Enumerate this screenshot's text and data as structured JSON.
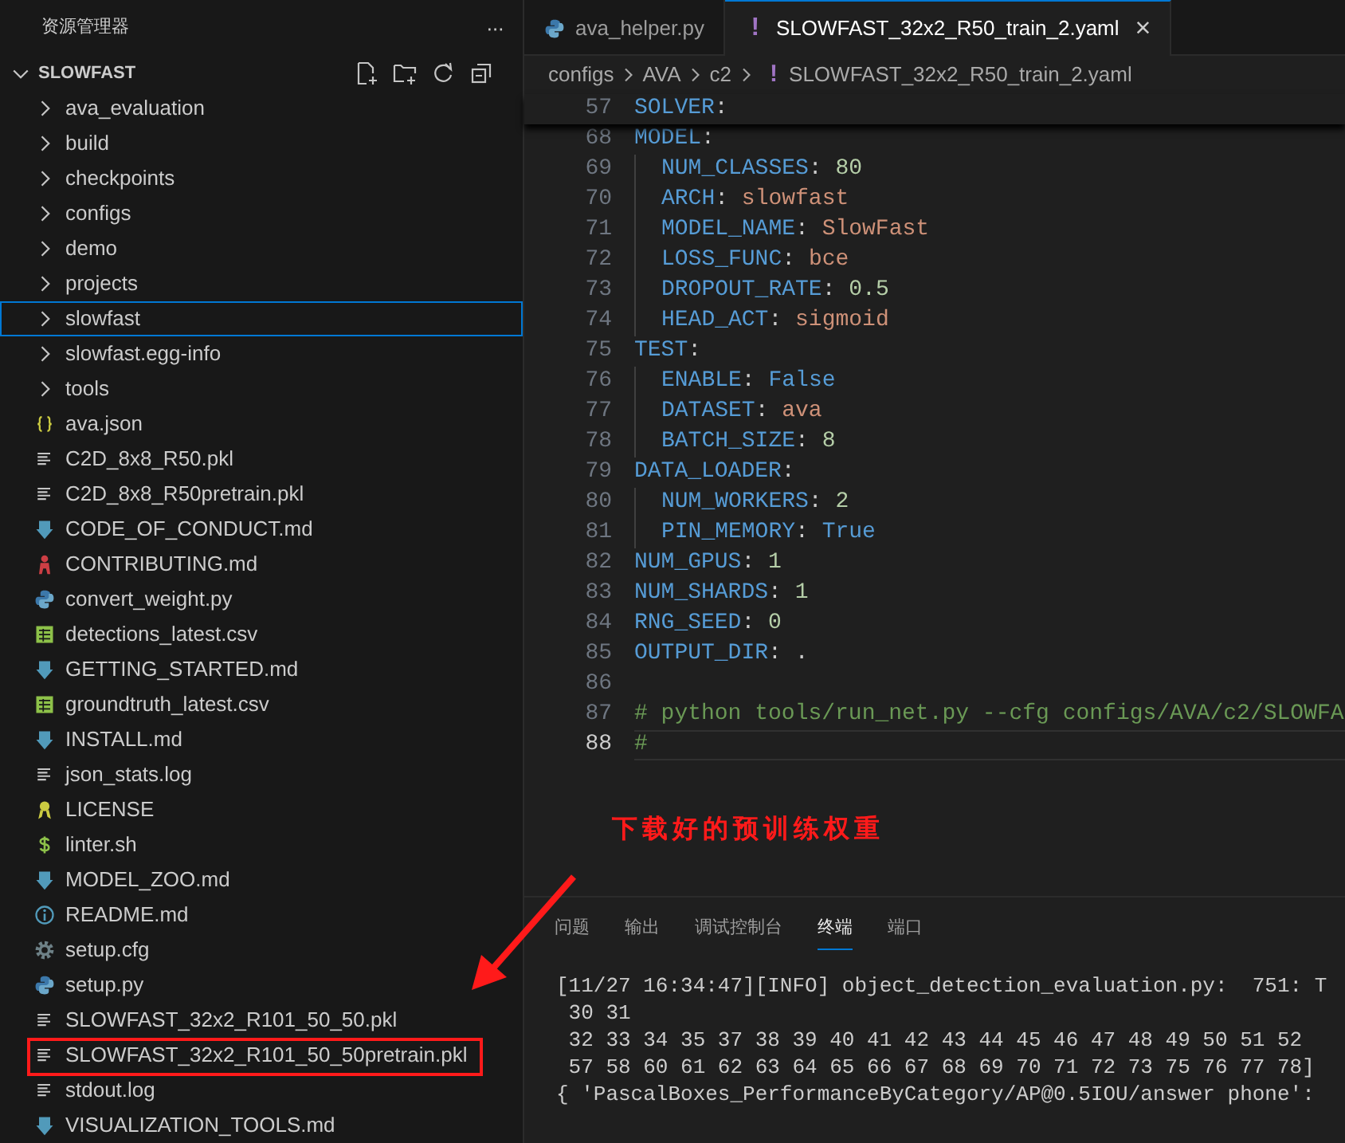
{
  "explorer": {
    "title": "资源管理器",
    "more": "···",
    "root": {
      "label": "SLOWFAST",
      "expanded": true
    },
    "items": [
      {
        "label": "ava_evaluation",
        "kind": "folder",
        "focused": false,
        "annotated": false
      },
      {
        "label": "build",
        "kind": "folder",
        "focused": false,
        "annotated": false
      },
      {
        "label": "checkpoints",
        "kind": "folder",
        "focused": false,
        "annotated": false
      },
      {
        "label": "configs",
        "kind": "folder",
        "focused": false,
        "annotated": false
      },
      {
        "label": "demo",
        "kind": "folder",
        "focused": false,
        "annotated": false
      },
      {
        "label": "projects",
        "kind": "folder",
        "focused": false,
        "annotated": false
      },
      {
        "label": "slowfast",
        "kind": "folder",
        "focused": true,
        "annotated": false
      },
      {
        "label": "slowfast.egg-info",
        "kind": "folder",
        "focused": false,
        "annotated": false
      },
      {
        "label": "tools",
        "kind": "folder",
        "focused": false,
        "annotated": false
      },
      {
        "label": "ava.json",
        "kind": "json",
        "focused": false,
        "annotated": false
      },
      {
        "label": "C2D_8x8_R50.pkl",
        "kind": "lines",
        "focused": false,
        "annotated": false
      },
      {
        "label": "C2D_8x8_R50pretrain.pkl",
        "kind": "lines",
        "focused": false,
        "annotated": false
      },
      {
        "label": "CODE_OF_CONDUCT.md",
        "kind": "markdown",
        "focused": false,
        "annotated": false
      },
      {
        "label": "CONTRIBUTING.md",
        "kind": "contributing",
        "focused": false,
        "annotated": false
      },
      {
        "label": "convert_weight.py",
        "kind": "python",
        "focused": false,
        "annotated": false
      },
      {
        "label": "detections_latest.csv",
        "kind": "table",
        "focused": false,
        "annotated": false
      },
      {
        "label": "GETTING_STARTED.md",
        "kind": "markdown",
        "focused": false,
        "annotated": false
      },
      {
        "label": "groundtruth_latest.csv",
        "kind": "table",
        "focused": false,
        "annotated": false
      },
      {
        "label": "INSTALL.md",
        "kind": "markdown",
        "focused": false,
        "annotated": false
      },
      {
        "label": "json_stats.log",
        "kind": "lines",
        "focused": false,
        "annotated": false
      },
      {
        "label": "LICENSE",
        "kind": "license",
        "focused": false,
        "annotated": false
      },
      {
        "label": "linter.sh",
        "kind": "shell",
        "focused": false,
        "annotated": false
      },
      {
        "label": "MODEL_ZOO.md",
        "kind": "markdown",
        "focused": false,
        "annotated": false
      },
      {
        "label": "README.md",
        "kind": "info",
        "focused": false,
        "annotated": false
      },
      {
        "label": "setup.cfg",
        "kind": "gear",
        "focused": false,
        "annotated": false
      },
      {
        "label": "setup.py",
        "kind": "python",
        "focused": false,
        "annotated": false
      },
      {
        "label": "SLOWFAST_32x2_R101_50_50.pkl",
        "kind": "lines",
        "focused": false,
        "annotated": false
      },
      {
        "label": "SLOWFAST_32x2_R101_50_50pretrain.pkl",
        "kind": "lines",
        "focused": false,
        "annotated": true
      },
      {
        "label": "stdout.log",
        "kind": "lines",
        "focused": false,
        "annotated": false
      },
      {
        "label": "VISUALIZATION_TOOLS.md",
        "kind": "markdown",
        "focused": false,
        "annotated": false
      }
    ]
  },
  "tabs": [
    {
      "label": "ava_helper.py",
      "kind": "python",
      "selected": false
    },
    {
      "label": "SLOWFAST_32x2_R50_train_2.yaml",
      "kind": "yaml",
      "glyph": "!",
      "selected": true,
      "close": "×"
    }
  ],
  "breadcrumb": {
    "parts": [
      "configs",
      "AVA",
      "c2"
    ],
    "glyph": "!",
    "file": "SLOWFAST_32x2_R50_train_2.yaml"
  },
  "code": {
    "sticky": {
      "number": "57",
      "tokens": [
        {
          "kind": "key",
          "text": "SOLVER"
        },
        {
          "kind": "punct",
          "text": ":"
        }
      ]
    },
    "lines": [
      {
        "number": "68",
        "indented": false,
        "current": false,
        "tokens": [
          {
            "kind": "key",
            "text": "MODEL"
          },
          {
            "kind": "punct",
            "text": ":"
          }
        ]
      },
      {
        "number": "69",
        "indented": true,
        "current": false,
        "tokens": [
          {
            "kind": "key",
            "text": "NUM_CLASSES"
          },
          {
            "kind": "punct",
            "text": ": "
          },
          {
            "kind": "number",
            "text": "80"
          }
        ]
      },
      {
        "number": "70",
        "indented": true,
        "current": false,
        "tokens": [
          {
            "kind": "key",
            "text": "ARCH"
          },
          {
            "kind": "punct",
            "text": ": "
          },
          {
            "kind": "string",
            "text": "slowfast"
          }
        ]
      },
      {
        "number": "71",
        "indented": true,
        "current": false,
        "tokens": [
          {
            "kind": "key",
            "text": "MODEL_NAME"
          },
          {
            "kind": "punct",
            "text": ": "
          },
          {
            "kind": "string",
            "text": "SlowFast"
          }
        ]
      },
      {
        "number": "72",
        "indented": true,
        "current": false,
        "tokens": [
          {
            "kind": "key",
            "text": "LOSS_FUNC"
          },
          {
            "kind": "punct",
            "text": ": "
          },
          {
            "kind": "string",
            "text": "bce"
          }
        ]
      },
      {
        "number": "73",
        "indented": true,
        "current": false,
        "tokens": [
          {
            "kind": "key",
            "text": "DROPOUT_RATE"
          },
          {
            "kind": "punct",
            "text": ": "
          },
          {
            "kind": "number",
            "text": "0.5"
          }
        ]
      },
      {
        "number": "74",
        "indented": true,
        "current": false,
        "tokens": [
          {
            "kind": "key",
            "text": "HEAD_ACT"
          },
          {
            "kind": "punct",
            "text": ": "
          },
          {
            "kind": "string",
            "text": "sigmoid"
          }
        ]
      },
      {
        "number": "75",
        "indented": false,
        "current": false,
        "tokens": [
          {
            "kind": "key",
            "text": "TEST"
          },
          {
            "kind": "punct",
            "text": ":"
          }
        ]
      },
      {
        "number": "76",
        "indented": true,
        "current": false,
        "tokens": [
          {
            "kind": "key",
            "text": "ENABLE"
          },
          {
            "kind": "punct",
            "text": ": "
          },
          {
            "kind": "bool",
            "text": "False"
          }
        ]
      },
      {
        "number": "77",
        "indented": true,
        "current": false,
        "tokens": [
          {
            "kind": "key",
            "text": "DATASET"
          },
          {
            "kind": "punct",
            "text": ": "
          },
          {
            "kind": "string",
            "text": "ava"
          }
        ]
      },
      {
        "number": "78",
        "indented": true,
        "current": false,
        "tokens": [
          {
            "kind": "key",
            "text": "BATCH_SIZE"
          },
          {
            "kind": "punct",
            "text": ": "
          },
          {
            "kind": "number",
            "text": "8"
          }
        ]
      },
      {
        "number": "79",
        "indented": false,
        "current": false,
        "tokens": [
          {
            "kind": "key",
            "text": "DATA_LOADER"
          },
          {
            "kind": "punct",
            "text": ":"
          }
        ]
      },
      {
        "number": "80",
        "indented": true,
        "current": false,
        "tokens": [
          {
            "kind": "key",
            "text": "NUM_WORKERS"
          },
          {
            "kind": "punct",
            "text": ": "
          },
          {
            "kind": "number",
            "text": "2"
          }
        ]
      },
      {
        "number": "81",
        "indented": true,
        "current": false,
        "tokens": [
          {
            "kind": "key",
            "text": "PIN_MEMORY"
          },
          {
            "kind": "punct",
            "text": ": "
          },
          {
            "kind": "bool",
            "text": "True"
          }
        ]
      },
      {
        "number": "82",
        "indented": false,
        "current": false,
        "tokens": [
          {
            "kind": "key",
            "text": "NUM_GPUS"
          },
          {
            "kind": "punct",
            "text": ": "
          },
          {
            "kind": "number",
            "text": "1"
          }
        ]
      },
      {
        "number": "83",
        "indented": false,
        "current": false,
        "tokens": [
          {
            "kind": "key",
            "text": "NUM_SHARDS"
          },
          {
            "kind": "punct",
            "text": ": "
          },
          {
            "kind": "number",
            "text": "1"
          }
        ]
      },
      {
        "number": "84",
        "indented": false,
        "current": false,
        "tokens": [
          {
            "kind": "key",
            "text": "RNG_SEED"
          },
          {
            "kind": "punct",
            "text": ": "
          },
          {
            "kind": "number",
            "text": "0"
          }
        ]
      },
      {
        "number": "85",
        "indented": false,
        "current": false,
        "tokens": [
          {
            "kind": "key",
            "text": "OUTPUT_DIR"
          },
          {
            "kind": "punct",
            "text": ": ."
          }
        ]
      },
      {
        "number": "86",
        "indented": false,
        "current": false
      },
      {
        "number": "87",
        "indented": false,
        "current": false,
        "tokens": [
          {
            "kind": "comment",
            "text": "# python tools/run_net.py --cfg configs/AVA/c2/SLOWFA"
          }
        ]
      },
      {
        "number": "88",
        "indented": false,
        "current": true,
        "tokens": [
          {
            "kind": "comment",
            "text": "#"
          }
        ]
      }
    ]
  },
  "annotation": {
    "note": "下载好的预训练权重"
  },
  "panel": {
    "tabs": [
      {
        "label": "问题",
        "selected": false
      },
      {
        "label": "输出",
        "selected": false
      },
      {
        "label": "调试控制台",
        "selected": false
      },
      {
        "label": "终端",
        "selected": true
      },
      {
        "label": "端口",
        "selected": false
      }
    ],
    "terminal": [
      "[11/27 16:34:47][INFO] object_detection_evaluation.py:  751: T",
      " 30 31",
      " 32 33 34 35 37 38 39 40 41 42 43 44 45 46 47 48 49 50 51 52",
      " 57 58 60 61 62 63 64 65 66 67 68 69 70 71 72 73 75 76 77 78]",
      "{ 'PascalBoxes_PerformanceByCategory/AP@0.5IOU/answer phone':"
    ]
  }
}
